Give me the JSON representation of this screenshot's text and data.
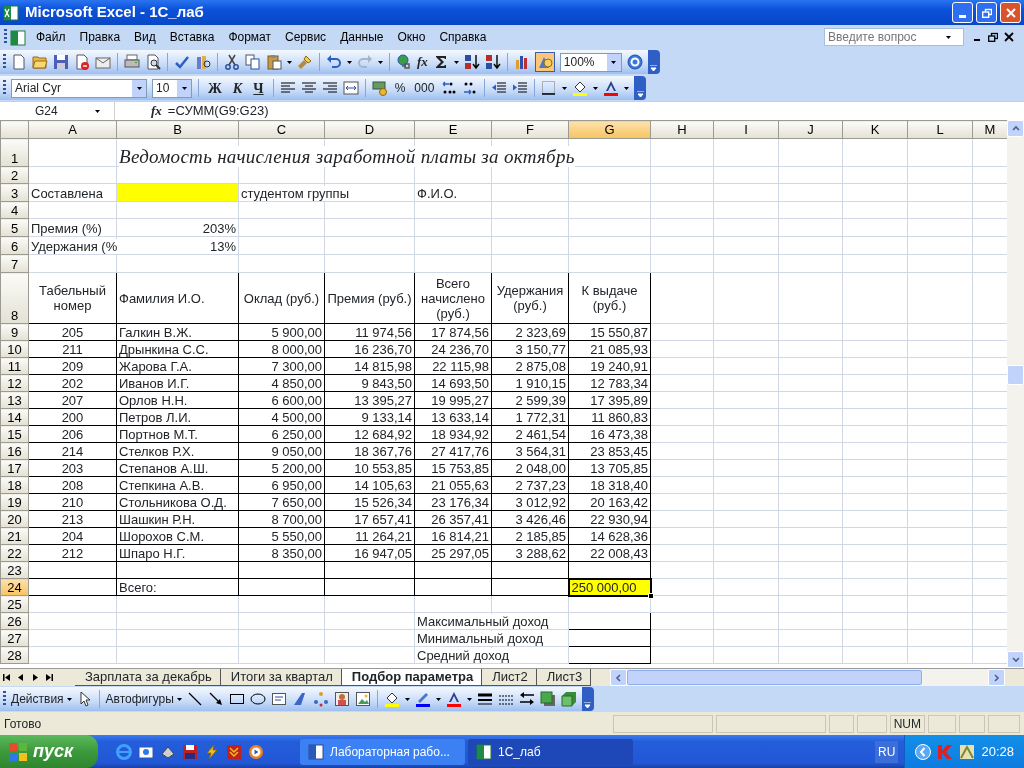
{
  "window": {
    "title": "Microsoft Excel - 1С_лаб"
  },
  "menu": [
    "Файл",
    "Правка",
    "Вид",
    "Вставка",
    "Формат",
    "Сервис",
    "Данные",
    "Окно",
    "Справка"
  ],
  "help_search": {
    "placeholder": "Введите вопрос"
  },
  "standard_toolbar": {
    "insert_function": "fx",
    "zoom": "100%",
    "drawing_pressed": true
  },
  "formatting_toolbar": {
    "font": "Arial Cyr",
    "size": "10",
    "style_buttons": [
      "Ж",
      "К",
      "Ч"
    ],
    "number_buttons": [
      "%",
      "000"
    ]
  },
  "formula_bar": {
    "name_box": "G24",
    "fx": "fx",
    "formula": "=СУММ(G9:G23)"
  },
  "columns": [
    {
      "letter": "A",
      "selected": false
    },
    {
      "letter": "B",
      "selected": false
    },
    {
      "letter": "C",
      "selected": false
    },
    {
      "letter": "D",
      "selected": false
    },
    {
      "letter": "E",
      "selected": false
    },
    {
      "letter": "F",
      "selected": false
    },
    {
      "letter": "G",
      "selected": true
    },
    {
      "letter": "H",
      "selected": false
    },
    {
      "letter": "I",
      "selected": false
    },
    {
      "letter": "J",
      "selected": false
    },
    {
      "letter": "K",
      "selected": false
    },
    {
      "letter": "L",
      "selected": false
    },
    {
      "letter": "M",
      "selected": false
    }
  ],
  "rows": [
    {
      "number": "1",
      "selected": false,
      "cells": [
        {},
        {
          "text": "Ведомость начисления заработной платы за октябрь",
          "kind": "title"
        }
      ]
    },
    {
      "number": "2",
      "selected": false
    },
    {
      "number": "3",
      "selected": false,
      "cells": [
        {
          "text": "Составлена",
          "kind": "text"
        },
        {
          "highlighted": true
        },
        {
          "text": "студентом группы",
          "kind": "text"
        },
        {},
        {
          "text": "Ф.И.О.",
          "kind": "text"
        }
      ]
    },
    {
      "number": "4",
      "selected": false
    },
    {
      "number": "5",
      "selected": false,
      "cells": [
        {
          "text": "Премия (%)",
          "kind": "text"
        },
        {
          "text": "203%",
          "kind": "number"
        }
      ]
    },
    {
      "number": "6",
      "selected": false,
      "cells": [
        {
          "text": "Удержания (%",
          "kind": "text"
        },
        {
          "text": "13%",
          "kind": "number"
        }
      ]
    },
    {
      "number": "7",
      "selected": false
    },
    {
      "number": "8",
      "selected": false,
      "kind": "table_header",
      "values": [
        "Табельный номер",
        "Фамилия И.О.",
        "Оклад (руб.)",
        "Премия (руб.)",
        "Всего начислено (руб.)",
        "Удержания (руб.)",
        "К выдаче (руб.)"
      ]
    },
    {
      "number": "9",
      "selected": false,
      "kind": "record",
      "values": [
        "205",
        "Галкин В.Ж.",
        "5 900,00",
        "11 974,56",
        "17 874,56",
        "2 323,69",
        "15 550,87"
      ]
    },
    {
      "number": "10",
      "selected": false,
      "kind": "record",
      "values": [
        "211",
        "Дрынкина С.С.",
        "8 000,00",
        "16 236,70",
        "24 236,70",
        "3 150,77",
        "21 085,93"
      ]
    },
    {
      "number": "11",
      "selected": false,
      "kind": "record",
      "values": [
        "209",
        "Жарова Г.А.",
        "7 300,00",
        "14 815,98",
        "22 115,98",
        "2 875,08",
        "19 240,91"
      ]
    },
    {
      "number": "12",
      "selected": false,
      "kind": "record",
      "values": [
        "202",
        "Иванов И.Г.",
        "4 850,00",
        "9 843,50",
        "14 693,50",
        "1 910,15",
        "12 783,34"
      ]
    },
    {
      "number": "13",
      "selected": false,
      "kind": "record",
      "values": [
        "207",
        "Орлов Н.Н.",
        "6 600,00",
        "13 395,27",
        "19 995,27",
        "2 599,39",
        "17 395,89"
      ]
    },
    {
      "number": "14",
      "selected": false,
      "kind": "record",
      "values": [
        "200",
        "Петров Л.И.",
        "4 500,00",
        "9 133,14",
        "13 633,14",
        "1 772,31",
        "11 860,83"
      ]
    },
    {
      "number": "15",
      "selected": false,
      "kind": "record",
      "values": [
        "206",
        "Портнов М.Т.",
        "6 250,00",
        "12 684,92",
        "18 934,92",
        "2 461,54",
        "16 473,38"
      ]
    },
    {
      "number": "16",
      "selected": false,
      "kind": "record",
      "values": [
        "214",
        "Стелков Р.Х.",
        "9 050,00",
        "18 367,76",
        "27 417,76",
        "3 564,31",
        "23 853,45"
      ]
    },
    {
      "number": "17",
      "selected": false,
      "kind": "record",
      "values": [
        "203",
        "Степанов А.Ш.",
        "5 200,00",
        "10 553,85",
        "15 753,85",
        "2 048,00",
        "13 705,85"
      ]
    },
    {
      "number": "18",
      "selected": false,
      "kind": "record",
      "values": [
        "208",
        "Степкина А.В.",
        "6 950,00",
        "14 105,63",
        "21 055,63",
        "2 737,23",
        "18 318,40"
      ]
    },
    {
      "number": "19",
      "selected": false,
      "kind": "record",
      "values": [
        "210",
        "Стольникова О.Д.",
        "7 650,00",
        "15 526,34",
        "23 176,34",
        "3 012,92",
        "20 163,42"
      ]
    },
    {
      "number": "20",
      "selected": false,
      "kind": "record",
      "values": [
        "213",
        "Шашкин Р.Н.",
        "8 700,00",
        "17 657,41",
        "26 357,41",
        "3 426,46",
        "22 930,94"
      ]
    },
    {
      "number": "21",
      "selected": false,
      "kind": "record",
      "values": [
        "204",
        "Шорохов С.М.",
        "5 550,00",
        "11 264,21",
        "16 814,21",
        "2 185,85",
        "14 628,36"
      ]
    },
    {
      "number": "22",
      "selected": false,
      "kind": "record",
      "values": [
        "212",
        "Шпаро Н.Г.",
        "8 350,00",
        "16 947,05",
        "25 297,05",
        "3 288,62",
        "22 008,43"
      ]
    },
    {
      "number": "23",
      "selected": false,
      "kind": "record"
    },
    {
      "number": "24",
      "selected": true,
      "kind": "total",
      "cells": [
        {},
        {
          "text": "Всего:",
          "kind": "text"
        },
        {},
        {},
        {},
        {},
        {
          "text": "250 000,00",
          "kind": "text",
          "highlighted": true,
          "selected": true
        }
      ]
    },
    {
      "number": "25",
      "selected": false
    },
    {
      "number": "26",
      "selected": false,
      "cells": [
        {},
        {},
        {},
        {},
        {
          "text": "Максимальный доход",
          "kind": "text"
        },
        {},
        {
          "border": true
        }
      ]
    },
    {
      "number": "27",
      "selected": false,
      "cells": [
        {},
        {},
        {},
        {},
        {
          "text": "Минимальный доход",
          "kind": "text"
        },
        {},
        {
          "border": true
        }
      ]
    },
    {
      "number": "28",
      "selected": false,
      "cells": [
        {},
        {},
        {},
        {},
        {
          "text": "Средний доход",
          "kind": "text"
        },
        {},
        {
          "border": true
        }
      ]
    }
  ],
  "sheet_tabs": [
    {
      "label": "Зарплата за декабрь",
      "selected": false
    },
    {
      "label": "Итоги за квартал",
      "selected": false
    },
    {
      "label": "Подбор параметра",
      "selected": true
    },
    {
      "label": "Лист2",
      "selected": false
    },
    {
      "label": "Лист3",
      "selected": false
    }
  ],
  "drawing_toolbar": {
    "actions": "Действия",
    "autoshapes": "Автофигуры"
  },
  "status_bar": {
    "text": "Готово",
    "indicator": "NUM"
  },
  "taskbar": {
    "start": "пуск",
    "tasks": [
      {
        "label": "Лабораторная рабо...",
        "selected": false
      },
      {
        "label": "1С_лаб",
        "selected": true
      }
    ],
    "language": "RU",
    "clock": "20:28"
  }
}
